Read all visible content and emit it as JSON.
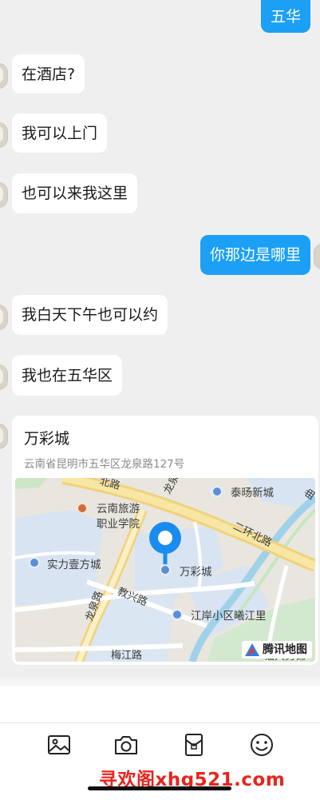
{
  "messages": [
    {
      "side": "right",
      "text": "五华"
    },
    {
      "side": "left",
      "text": "在酒店?"
    },
    {
      "side": "left",
      "text": "我可以上门"
    },
    {
      "side": "left",
      "text": "也可以来我这里"
    },
    {
      "side": "right",
      "text": "你那边是哪里"
    },
    {
      "side": "left",
      "text": "我白天下午也可以约"
    },
    {
      "side": "left",
      "text": "我也在五华区"
    }
  ],
  "location_card": {
    "title": "万彩城",
    "address": "云南省昆明市五华区龙泉路127号",
    "map": {
      "labels": {
        "tourism_school": "云南旅游",
        "tourism_school_2": "职业学院",
        "taiyang": "泰旸新城",
        "shili": "实力壹方城",
        "wancai": "万彩城",
        "jiangan": "江岸小区曦江里",
        "erhuan": "二环北路",
        "longquan_top": "龙泉路",
        "beilu": "北路",
        "jiaoxing": "教兴路",
        "longquan_bottom": "龙泉路",
        "meijiang": "梅江路",
        "partial_right": "曲",
        "partial_bottom": "猫兴男锦"
      },
      "provider": "腾讯地图"
    }
  },
  "toolbar": {
    "icons": [
      "image-icon",
      "camera-icon",
      "red-packet-icon",
      "emoji-icon"
    ]
  },
  "watermark": "寻欢阁xhg521.com",
  "colors": {
    "bubble_right": "#1ba0f5",
    "bubble_left": "#ffffff",
    "background": "#efefef",
    "watermark": "#e8241c"
  }
}
